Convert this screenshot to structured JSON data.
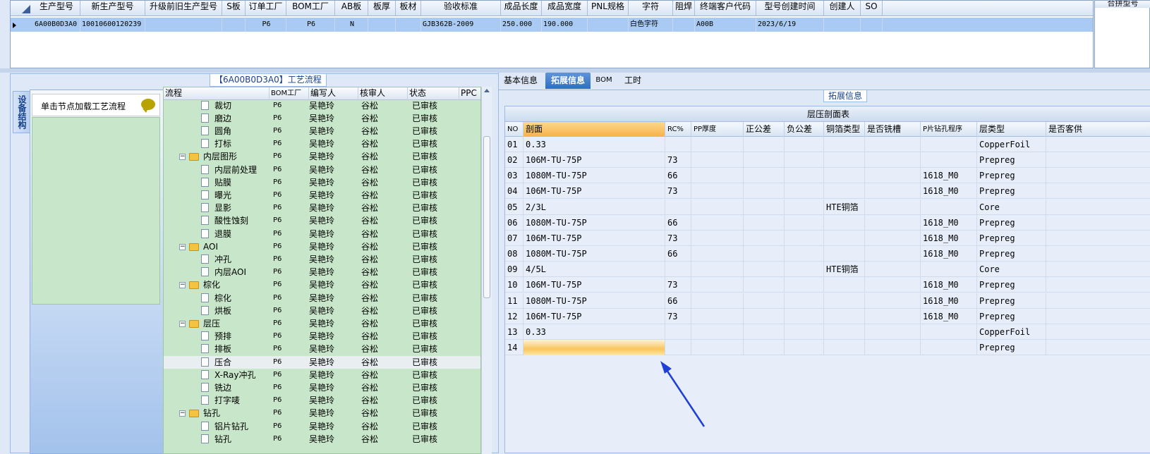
{
  "top_grid": {
    "columns": [
      "生产型号",
      "新生产型号",
      "升级前旧生产型号",
      "S板",
      "订单工厂",
      "BOM工厂",
      "AB板",
      "板厚",
      "板材",
      "验收标准",
      "成品长度",
      "成品宽度",
      "PNL规格",
      "字符",
      "阻焊",
      "终端客户代码",
      "型号创建时间",
      "创建人",
      "SO"
    ],
    "row": [
      "6A00B0D3A0",
      "10010600120239",
      "",
      "",
      "P6",
      "P6",
      "N",
      "",
      "",
      "GJB362B-2009",
      "250.000",
      "190.000",
      "",
      "白色字符",
      "",
      "A00B",
      "2023/6/19",
      "",
      ""
    ]
  },
  "right_pane": {
    "title": "合拼型号"
  },
  "left_panel": {
    "flow_title": "【6A00B0D3A0】工艺流程",
    "vertical_tab": "设备结构",
    "device_header": "单击节点加载工艺流程",
    "tree_columns": [
      "流程",
      "BOM工厂",
      "编写人",
      "核审人",
      "状态",
      "PPC"
    ],
    "tree_rows": [
      {
        "name": "裁切",
        "level": 2,
        "folder": false,
        "bom": "P6",
        "writer": "吴艳玲",
        "reviewer": "谷松",
        "status": "已审核"
      },
      {
        "name": "磨边",
        "level": 2,
        "folder": false,
        "bom": "P6",
        "writer": "吴艳玲",
        "reviewer": "谷松",
        "status": "已审核"
      },
      {
        "name": "圆角",
        "level": 2,
        "folder": false,
        "bom": "P6",
        "writer": "吴艳玲",
        "reviewer": "谷松",
        "status": "已审核"
      },
      {
        "name": "打标",
        "level": 2,
        "folder": false,
        "bom": "P6",
        "writer": "吴艳玲",
        "reviewer": "谷松",
        "status": "已审核"
      },
      {
        "name": "内层图形",
        "level": 1,
        "folder": true,
        "bom": "P6",
        "writer": "吴艳玲",
        "reviewer": "谷松",
        "status": "已审核"
      },
      {
        "name": "内层前处理",
        "level": 2,
        "folder": false,
        "bom": "P6",
        "writer": "吴艳玲",
        "reviewer": "谷松",
        "status": "已审核"
      },
      {
        "name": "贴膜",
        "level": 2,
        "folder": false,
        "bom": "P6",
        "writer": "吴艳玲",
        "reviewer": "谷松",
        "status": "已审核"
      },
      {
        "name": "曝光",
        "level": 2,
        "folder": false,
        "bom": "P6",
        "writer": "吴艳玲",
        "reviewer": "谷松",
        "status": "已审核"
      },
      {
        "name": "显影",
        "level": 2,
        "folder": false,
        "bom": "P6",
        "writer": "吴艳玲",
        "reviewer": "谷松",
        "status": "已审核"
      },
      {
        "name": "酸性蚀刻",
        "level": 2,
        "folder": false,
        "bom": "P6",
        "writer": "吴艳玲",
        "reviewer": "谷松",
        "status": "已审核"
      },
      {
        "name": "退膜",
        "level": 2,
        "folder": false,
        "bom": "P6",
        "writer": "吴艳玲",
        "reviewer": "谷松",
        "status": "已审核"
      },
      {
        "name": "AOI",
        "level": 1,
        "folder": true,
        "bom": "P6",
        "writer": "吴艳玲",
        "reviewer": "谷松",
        "status": "已审核"
      },
      {
        "name": "冲孔",
        "level": 2,
        "folder": false,
        "bom": "P6",
        "writer": "吴艳玲",
        "reviewer": "谷松",
        "status": "已审核"
      },
      {
        "name": "内层AOI",
        "level": 2,
        "folder": false,
        "bom": "P6",
        "writer": "吴艳玲",
        "reviewer": "谷松",
        "status": "已审核"
      },
      {
        "name": "棕化",
        "level": 1,
        "folder": true,
        "bom": "P6",
        "writer": "吴艳玲",
        "reviewer": "谷松",
        "status": "已审核"
      },
      {
        "name": "棕化",
        "level": 2,
        "folder": false,
        "bom": "P6",
        "writer": "吴艳玲",
        "reviewer": "谷松",
        "status": "已审核"
      },
      {
        "name": "烘板",
        "level": 2,
        "folder": false,
        "bom": "P6",
        "writer": "吴艳玲",
        "reviewer": "谷松",
        "status": "已审核"
      },
      {
        "name": "层压",
        "level": 1,
        "folder": true,
        "bom": "P6",
        "writer": "吴艳玲",
        "reviewer": "谷松",
        "status": "已审核"
      },
      {
        "name": "预排",
        "level": 2,
        "folder": false,
        "bom": "P6",
        "writer": "吴艳玲",
        "reviewer": "谷松",
        "status": "已审核"
      },
      {
        "name": "排板",
        "level": 2,
        "folder": false,
        "bom": "P6",
        "writer": "吴艳玲",
        "reviewer": "谷松",
        "status": "已审核"
      },
      {
        "name": "压合",
        "level": 2,
        "folder": false,
        "bom": "P6",
        "writer": "吴艳玲",
        "reviewer": "谷松",
        "status": "已审核",
        "selected": true
      },
      {
        "name": "X-Ray冲孔",
        "level": 2,
        "folder": false,
        "bom": "P6",
        "writer": "吴艳玲",
        "reviewer": "谷松",
        "status": "已审核"
      },
      {
        "name": "铣边",
        "level": 2,
        "folder": false,
        "bom": "P6",
        "writer": "吴艳玲",
        "reviewer": "谷松",
        "status": "已审核"
      },
      {
        "name": "打字唛",
        "level": 2,
        "folder": false,
        "bom": "P6",
        "writer": "吴艳玲",
        "reviewer": "谷松",
        "status": "已审核"
      },
      {
        "name": "钻孔",
        "level": 1,
        "folder": true,
        "bom": "P6",
        "writer": "吴艳玲",
        "reviewer": "谷松",
        "status": "已审核"
      },
      {
        "name": "铝片钻孔",
        "level": 2,
        "folder": false,
        "bom": "P6",
        "writer": "吴艳玲",
        "reviewer": "谷松",
        "status": "已审核"
      },
      {
        "name": "钻孔",
        "level": 2,
        "folder": false,
        "bom": "P6",
        "writer": "吴艳玲",
        "reviewer": "谷松",
        "status": "已审核"
      }
    ]
  },
  "right_section": {
    "tabs": [
      "基本信息",
      "拓展信息",
      "BOM",
      "工时"
    ],
    "active_tab": 1,
    "fieldset_label": "拓展信息",
    "stack_title": "层压剖面表",
    "stack_columns": [
      "NO",
      "剖面",
      "RC%",
      "PP厚度",
      "正公差",
      "负公差",
      "铜箔类型",
      "是否铣槽",
      "P片钻孔程序",
      "层类型",
      "是否客供"
    ],
    "stack_rows": [
      [
        "01",
        "0.33",
        "",
        "",
        "",
        "",
        "",
        "",
        "",
        "CopperFoil",
        ""
      ],
      [
        "02",
        "106M-TU-75P",
        "73",
        "",
        "",
        "",
        "",
        "",
        "",
        "Prepreg",
        ""
      ],
      [
        "03",
        "1080M-TU-75P",
        "66",
        "",
        "",
        "",
        "",
        "",
        "1618_M0",
        "Prepreg",
        ""
      ],
      [
        "04",
        "106M-TU-75P",
        "73",
        "",
        "",
        "",
        "",
        "",
        "1618_M0",
        "Prepreg",
        ""
      ],
      [
        "05",
        "2/3L",
        "",
        "",
        "",
        "",
        "HTE铜箔",
        "",
        "",
        "Core",
        ""
      ],
      [
        "06",
        "1080M-TU-75P",
        "66",
        "",
        "",
        "",
        "",
        "",
        "1618_M0",
        "Prepreg",
        ""
      ],
      [
        "07",
        "106M-TU-75P",
        "73",
        "",
        "",
        "",
        "",
        "",
        "1618_M0",
        "Prepreg",
        ""
      ],
      [
        "08",
        "1080M-TU-75P",
        "66",
        "",
        "",
        "",
        "",
        "",
        "1618_M0",
        "Prepreg",
        ""
      ],
      [
        "09",
        "4/5L",
        "",
        "",
        "",
        "",
        "HTE铜箔",
        "",
        "",
        "Core",
        ""
      ],
      [
        "10",
        "106M-TU-75P",
        "73",
        "",
        "",
        "",
        "",
        "",
        "1618_M0",
        "Prepreg",
        ""
      ],
      [
        "11",
        "1080M-TU-75P",
        "66",
        "",
        "",
        "",
        "",
        "",
        "1618_M0",
        "Prepreg",
        ""
      ],
      [
        "12",
        "106M-TU-75P",
        "73",
        "",
        "",
        "",
        "",
        "",
        "1618_M0",
        "Prepreg",
        ""
      ],
      [
        "13",
        "0.33",
        "",
        "",
        "",
        "",
        "",
        "",
        "",
        "CopperFoil",
        ""
      ],
      [
        "14",
        "",
        "",
        "",
        "",
        "",
        "",
        "",
        "",
        "Prepreg",
        ""
      ]
    ],
    "editing_row": 13
  },
  "colors": {
    "selection": "#a9cbf3",
    "tree_bg": "#c8e6c9",
    "active_tab": "#2e6ec3",
    "arrow": "#1f3fd8",
    "highlight_header": "#f7b24a"
  }
}
